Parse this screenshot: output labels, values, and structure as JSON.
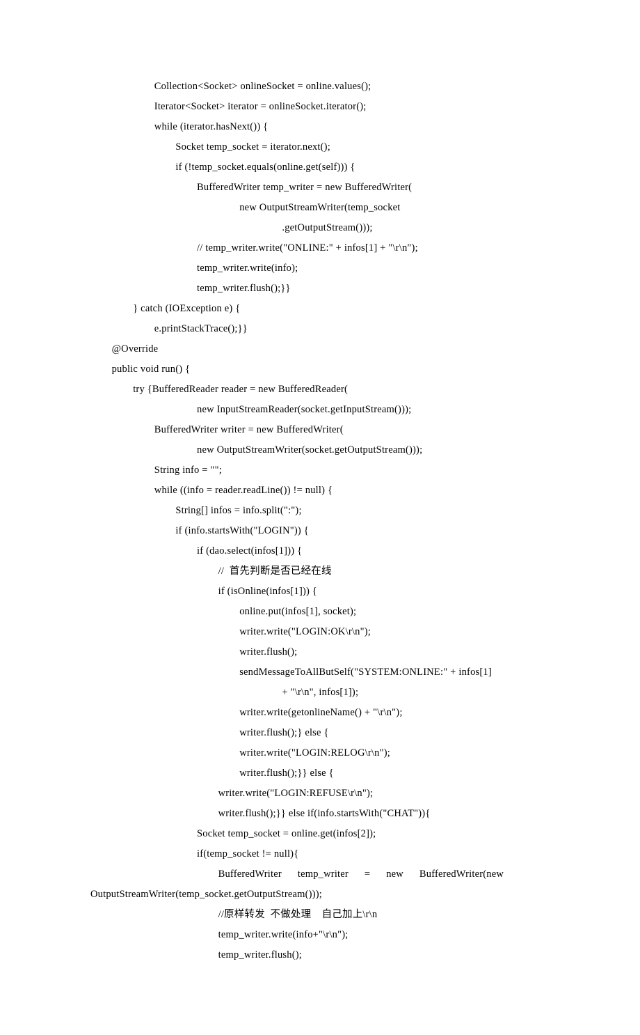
{
  "code_lines": [
    "                        Collection<Socket> onlineSocket = online.values();",
    "                        Iterator<Socket> iterator = onlineSocket.iterator();",
    "                        while (iterator.hasNext()) {",
    "                                Socket temp_socket = iterator.next();",
    "                                if (!temp_socket.equals(online.get(self))) {",
    "                                        BufferedWriter temp_writer = new BufferedWriter(",
    "                                                        new OutputStreamWriter(temp_socket",
    "                                                                        .getOutputStream()));",
    "                                        // temp_writer.write(\"ONLINE:\" + infos[1] + \"\\r\\n\");",
    "                                        temp_writer.write(info);",
    "                                        temp_writer.flush();}}",
    "                } catch (IOException e) {",
    "                        e.printStackTrace();}}",
    "        @Override",
    "        public void run() {",
    "                try {BufferedReader reader = new BufferedReader(",
    "                                        new InputStreamReader(socket.getInputStream()));",
    "                        BufferedWriter writer = new BufferedWriter(",
    "                                        new OutputStreamWriter(socket.getOutputStream()));",
    "                        String info = \"\";",
    "                        while ((info = reader.readLine()) != null) {",
    "                                String[] infos = info.split(\":\");",
    "                                if (info.startsWith(\"LOGIN\")) {",
    "                                        if (dao.select(infos[1])) {",
    "                                                //  首先判断是否已经在线",
    "                                                if (isOnline(infos[1])) {",
    "                                                        online.put(infos[1], socket);",
    "                                                        writer.write(\"LOGIN:OK\\r\\n\");",
    "                                                        writer.flush();",
    "                                                        sendMessageToAllButSelf(\"SYSTEM:ONLINE:\" + infos[1]",
    "                                                                        + \"\\r\\n\", infos[1]);",
    "                                                        writer.write(getonlineName() + \"\\r\\n\");",
    "                                                        writer.flush();} else {",
    "                                                        writer.write(\"LOGIN:RELOG\\r\\n\");",
    "                                                        writer.flush();}} else {",
    "                                                writer.write(\"LOGIN:REFUSE\\r\\n\");",
    "                                                writer.flush();}} else if(info.startsWith(\"CHAT\")){",
    "                                        Socket temp_socket = online.get(infos[2]);",
    "                                        if(temp_socket != null){"
  ],
  "wrapped_line": {
    "prefix": "                                                BufferedWriter      temp_writer      =      new      BufferedWriter(new",
    "continuation": "OutputStreamWriter(temp_socket.getOutputStream()));"
  },
  "code_lines_after": [
    "                                                //原样转发  不做处理    自己加上\\r\\n",
    "                                                temp_writer.write(info+\"\\r\\n\");",
    "                                                temp_writer.flush();"
  ]
}
